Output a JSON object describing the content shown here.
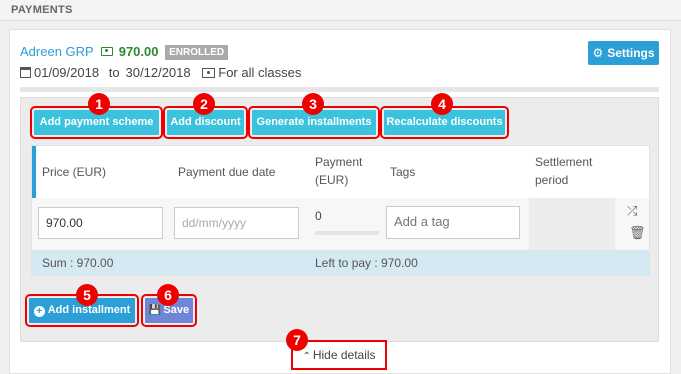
{
  "header": {
    "title": "PAYMENTS"
  },
  "student": {
    "name": "Adreen GRP",
    "amount": "970.00",
    "status": "ENROLLED",
    "date_from": "01/09/2018",
    "date_sep": "to",
    "date_to": "30/12/2018",
    "classes": "For all classes"
  },
  "settings_label": "Settings",
  "toolbar": {
    "add_payment_scheme": "Add payment scheme",
    "add_discount": "Add discount",
    "generate_installments": "Generate installments",
    "recalculate_discounts": "Recalculate discounts"
  },
  "table": {
    "headers": [
      "Price (EUR)",
      "Payment due date",
      "Payment (EUR)",
      "Tags",
      "Settlement period"
    ],
    "row": {
      "price": "970.00",
      "due_date_placeholder": "dd/mm/yyyy",
      "payment": "0",
      "tag_placeholder": "Add a tag"
    },
    "sum": "Sum : 970.00",
    "left_to_pay": "Left to pay : 970.00"
  },
  "actions": {
    "add_installment": "Add installment",
    "save": "Save",
    "hide_details": "Hide details"
  },
  "markers": [
    "1",
    "2",
    "3",
    "4",
    "5",
    "6",
    "7"
  ],
  "icons": {
    "money": "money-icon",
    "calendar": "calendar-icon",
    "classes": "class-icon",
    "gear": "gear-icon",
    "shuffle": "shuffle-icon",
    "trash": "trash-icon",
    "plus": "plus-circle-icon",
    "save": "floppy-icon",
    "chevron": "chevron-up-icon"
  },
  "colors": {
    "accent": "#2b9fd6",
    "button_cyan": "#3bc3de",
    "save_button": "#6f86d6",
    "amount_green": "#2c8a2c",
    "badge_grey": "#aaaaaa",
    "highlight_red": "#ee0000",
    "sum_row": "#d5e9f2"
  }
}
